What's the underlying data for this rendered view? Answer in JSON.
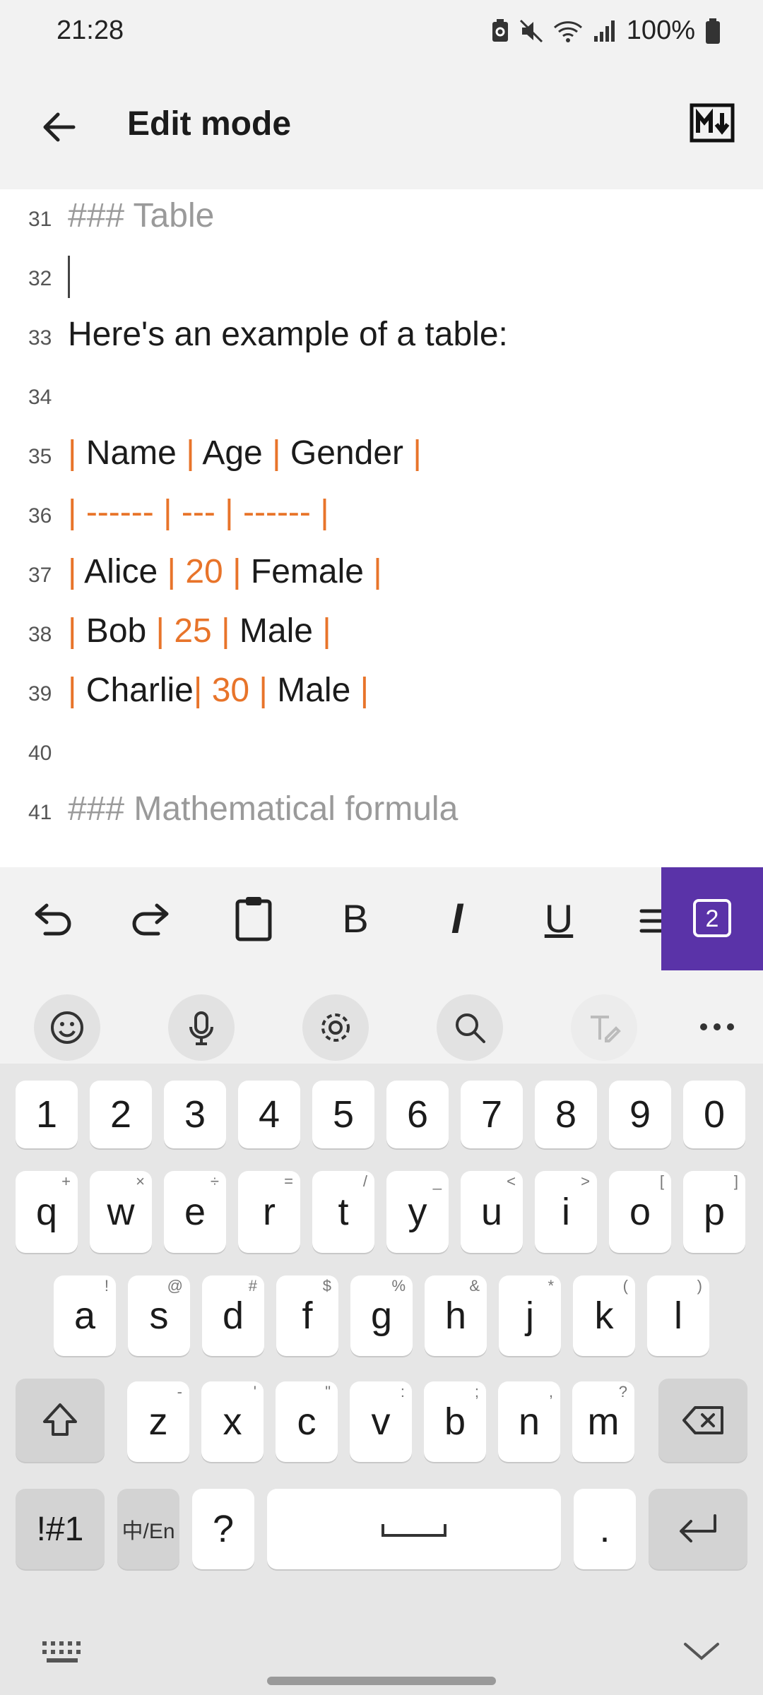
{
  "status": {
    "time": "21:28",
    "battery": "100%",
    "icons": [
      "battery-saver-icon",
      "mute-icon",
      "wifi-icon",
      "signal-icon",
      "battery-icon"
    ]
  },
  "appbar": {
    "title": "Edit mode",
    "back_icon": "back-arrow-icon",
    "md_icon": "markdown-icon"
  },
  "editor": {
    "lines": [
      {
        "n": "31",
        "text": "### Table"
      },
      {
        "n": "32",
        "text": ""
      },
      {
        "n": "33",
        "text": "Here's an example of a table:"
      },
      {
        "n": "34",
        "text": ""
      },
      {
        "n": "35",
        "text": "| Name | Age | Gender |"
      },
      {
        "n": "36",
        "text": "| ------ | --- | ------ |"
      },
      {
        "n": "37",
        "text": "| Alice | 20 | Female |"
      },
      {
        "n": "38",
        "text": "| Bob | 25 | Male |"
      },
      {
        "n": "39",
        "text": "| Charlie| 30 | Male |"
      },
      {
        "n": "40",
        "text": ""
      },
      {
        "n": "41",
        "text": "### Mathematical formula"
      }
    ]
  },
  "toolbar": {
    "buttons": [
      "undo-icon",
      "redo-icon",
      "clipboard-icon",
      "bold-icon",
      "italic-icon",
      "underline-icon",
      "strikethrough-icon",
      "heading-2-icon"
    ],
    "bold": "B",
    "italic": "I",
    "underline": "U",
    "h2": "2"
  },
  "kb_tools": [
    "emoji-icon",
    "mic-icon",
    "settings-icon",
    "search-icon",
    "handwriting-icon",
    "more-icon"
  ],
  "keyboard": {
    "numbers": [
      "1",
      "2",
      "3",
      "4",
      "5",
      "6",
      "7",
      "8",
      "9",
      "0"
    ],
    "row1": [
      {
        "k": "q",
        "s": "+"
      },
      {
        "k": "w",
        "s": "×"
      },
      {
        "k": "e",
        "s": "÷"
      },
      {
        "k": "r",
        "s": "="
      },
      {
        "k": "t",
        "s": "/"
      },
      {
        "k": "y",
        "s": "_"
      },
      {
        "k": "u",
        "s": "<"
      },
      {
        "k": "i",
        "s": ">"
      },
      {
        "k": "o",
        "s": "["
      },
      {
        "k": "p",
        "s": "]"
      }
    ],
    "row2": [
      {
        "k": "a",
        "s": "!"
      },
      {
        "k": "s",
        "s": "@"
      },
      {
        "k": "d",
        "s": "#"
      },
      {
        "k": "f",
        "s": "$"
      },
      {
        "k": "g",
        "s": "%"
      },
      {
        "k": "h",
        "s": "&"
      },
      {
        "k": "j",
        "s": "*"
      },
      {
        "k": "k",
        "s": "("
      },
      {
        "k": "l",
        "s": ")"
      }
    ],
    "row3": [
      {
        "k": "z",
        "s": "-"
      },
      {
        "k": "x",
        "s": "'"
      },
      {
        "k": "c",
        "s": "\""
      },
      {
        "k": "v",
        "s": ":"
      },
      {
        "k": "b",
        "s": ";"
      },
      {
        "k": "n",
        "s": ","
      },
      {
        "k": "m",
        "s": "?"
      }
    ],
    "sym": "!#1",
    "lang": "中/En",
    "question": "?",
    "period": "."
  }
}
